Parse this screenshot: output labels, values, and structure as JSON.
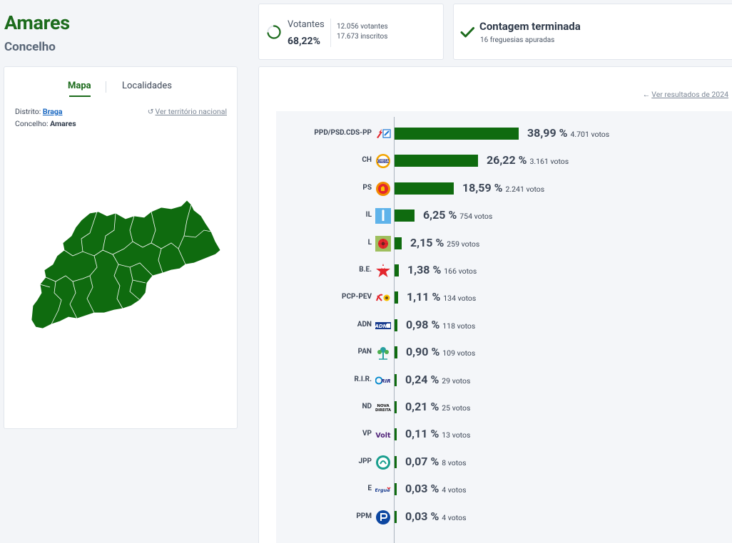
{
  "header": {
    "title": "Amares",
    "subtitle": "Concelho"
  },
  "votantes": {
    "label": "Votantes",
    "percent": "68,22%",
    "votantes_text": "12.056 votantes",
    "inscritos_text": "17.673 inscritos"
  },
  "contagem": {
    "title": "Contagem terminada",
    "subtitle": "16 freguesias apuradas"
  },
  "map_panel": {
    "tab_mapa": "Mapa",
    "tab_localidades": "Localidades",
    "distrito_label": "Distrito:",
    "distrito_value": "Braga",
    "concelho_label": "Concelho:",
    "concelho_value": "Amares",
    "ver_nacional": "Ver território nacional",
    "map_color": "#0f6b0f"
  },
  "results": {
    "ver_2024": "Ver resultados de 2024",
    "bar_color": "#0f6b0f",
    "parties": [
      {
        "name": "PPD/PSD.CDS-PP",
        "pct": "38,99 %",
        "votes": "4.701 votos",
        "value": 38.99,
        "logo": "psd-cds-logo"
      },
      {
        "name": "CH",
        "pct": "26,22 %",
        "votes": "3.161 votos",
        "value": 26.22,
        "logo": "chega-logo"
      },
      {
        "name": "PS",
        "pct": "18,59 %",
        "votes": "2.241 votos",
        "value": 18.59,
        "logo": "ps-logo"
      },
      {
        "name": "IL",
        "pct": "6,25 %",
        "votes": "754 votos",
        "value": 6.25,
        "logo": "il-logo"
      },
      {
        "name": "L",
        "pct": "2,15 %",
        "votes": "259 votos",
        "value": 2.15,
        "logo": "livre-logo"
      },
      {
        "name": "B.E.",
        "pct": "1,38 %",
        "votes": "166 votos",
        "value": 1.38,
        "logo": "be-logo"
      },
      {
        "name": "PCP-PEV",
        "pct": "1,11 %",
        "votes": "134 votos",
        "value": 1.11,
        "logo": "pcp-pev-logo"
      },
      {
        "name": "ADN",
        "pct": "0,98 %",
        "votes": "118 votos",
        "value": 0.98,
        "logo": "adn-logo"
      },
      {
        "name": "PAN",
        "pct": "0,90 %",
        "votes": "109 votos",
        "value": 0.9,
        "logo": "pan-logo"
      },
      {
        "name": "R.I.R.",
        "pct": "0,24 %",
        "votes": "29 votos",
        "value": 0.24,
        "logo": "rir-logo"
      },
      {
        "name": "ND",
        "pct": "0,21 %",
        "votes": "25 votos",
        "value": 0.21,
        "logo": "nova-direita-logo"
      },
      {
        "name": "VP",
        "pct": "0,11 %",
        "votes": "13 votos",
        "value": 0.11,
        "logo": "volt-logo"
      },
      {
        "name": "JPP",
        "pct": "0,07 %",
        "votes": "8 votos",
        "value": 0.07,
        "logo": "jpp-logo"
      },
      {
        "name": "E",
        "pct": "0,03 %",
        "votes": "4 votos",
        "value": 0.03,
        "logo": "ergue-te-logo"
      },
      {
        "name": "PPM",
        "pct": "0,03 %",
        "votes": "4 votos",
        "value": 0.03,
        "logo": "ppm-logo"
      }
    ]
  }
}
